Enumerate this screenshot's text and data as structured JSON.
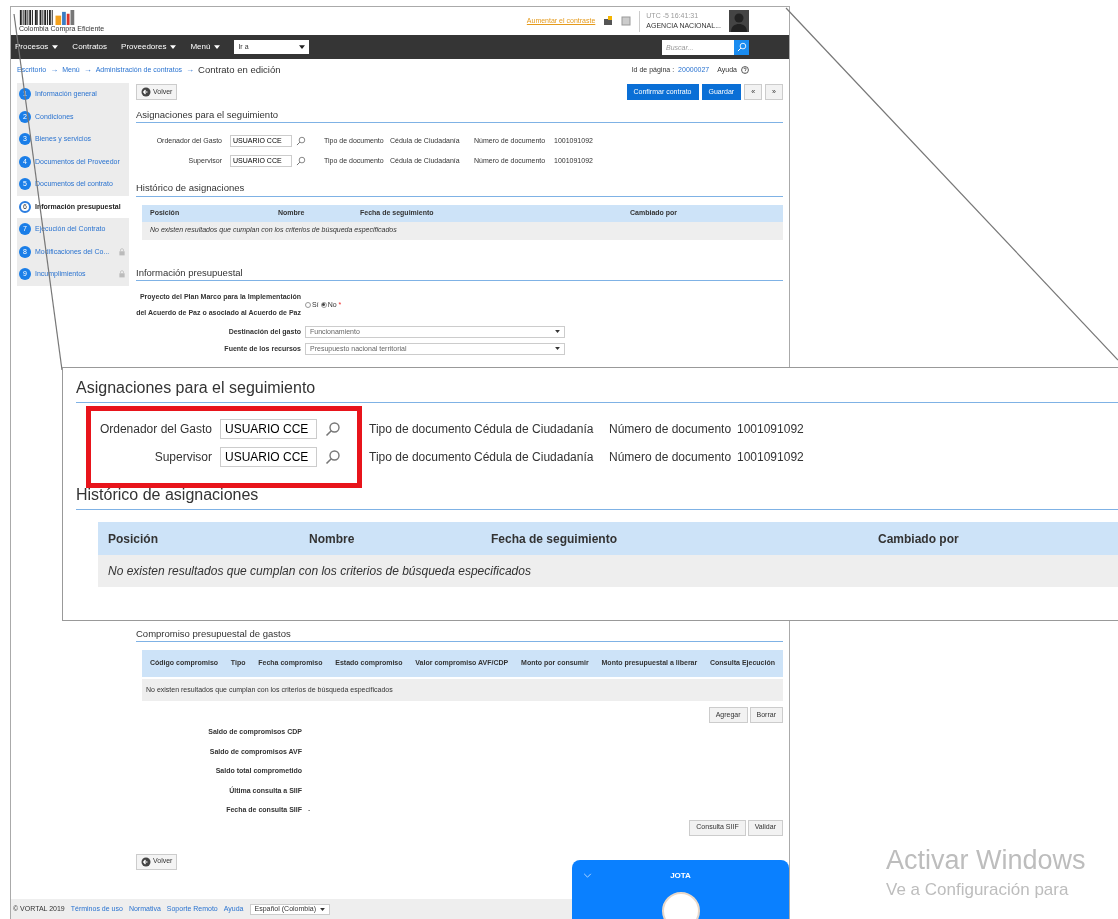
{
  "header": {
    "logo_caption": "Colombia Compra Eficiente",
    "contrast_link": "Aumentar el contraste",
    "time": "UTC -5 16:41:31",
    "agency": "AGENCIA NACIONAL..."
  },
  "nav": {
    "items": [
      {
        "label": "Procesos",
        "dropdown": true
      },
      {
        "label": "Contratos",
        "dropdown": false
      },
      {
        "label": "Proveedores",
        "dropdown": true
      },
      {
        "label": "Menú",
        "dropdown": true
      }
    ],
    "goto": "Ir a",
    "search": {
      "placeholder": "Buscar..."
    }
  },
  "breadcrumb": {
    "separator": "→",
    "links": [
      "Escritorio",
      "Menú",
      "Administración de contratos"
    ],
    "current": "Contrato en edición",
    "page_id_label": "Id de página :",
    "page_id": "20000027",
    "help": "Ayuda"
  },
  "steps": [
    {
      "number": "1",
      "label": "Información general",
      "selected": false,
      "locked": false
    },
    {
      "number": "2",
      "label": "Condiciones",
      "selected": false,
      "locked": false
    },
    {
      "number": "3",
      "label": "Bienes y servicios",
      "selected": false,
      "locked": false
    },
    {
      "number": "4",
      "label": "Documentos del Proveedor",
      "selected": false,
      "locked": false
    },
    {
      "number": "5",
      "label": "Documentos del contrato",
      "selected": false,
      "locked": false
    },
    {
      "number": "6",
      "label": "Información presupuestal",
      "selected": true,
      "locked": false
    },
    {
      "number": "7",
      "label": "Ejecución del Contrato",
      "selected": false,
      "locked": false
    },
    {
      "number": "8",
      "label": "Modificaciones del Co...",
      "selected": false,
      "locked": true
    },
    {
      "number": "9",
      "label": "Incumplimientos",
      "selected": false,
      "locked": true
    }
  ],
  "toolbar": {
    "back": "Volver",
    "buttons": [
      {
        "label": "Confirmar contrato",
        "kind": "primary"
      },
      {
        "label": "Guardar",
        "kind": "primary"
      },
      {
        "label": "«",
        "kind": "nav"
      },
      {
        "label": "»",
        "kind": "nav"
      }
    ]
  },
  "assignments": {
    "title": "Asignaciones para el seguimiento",
    "rows": [
      {
        "label": "Ordenador del Gasto",
        "value": "USUARIO CCE",
        "doc_type_label": "Tipo de documento",
        "doc_type": "Cédula de Ciudadanía",
        "doc_number_label": "Número de documento",
        "doc_number": "1001091092"
      },
      {
        "label": "Supervisor",
        "value": "USUARIO CCE",
        "doc_type_label": "Tipo de documento",
        "doc_type": "Cédula de Ciudadanía",
        "doc_number_label": "Número de documento",
        "doc_number": "1001091092"
      }
    ]
  },
  "history": {
    "title": "Histórico de asignaciones",
    "columns": [
      "Posición",
      "Nombre",
      "Fecha de seguimiento",
      "Cambiado por"
    ],
    "empty": "No existen resultados que cumplan con los criterios de búsqueda especificados"
  },
  "budget": {
    "title": "Información presupuestal",
    "peace_question": {
      "label_lines": [
        "Proyecto del Plan Marco para la Implementación",
        "del Acuerdo de Paz o asociado al Acuerdo de Paz"
      ],
      "options": [
        {
          "label": "Sí",
          "selected": false
        },
        {
          "label": "No",
          "selected": true
        }
      ],
      "required_mark": "*"
    },
    "selects": [
      {
        "label": "Destinación del gasto",
        "value": "Funcionamiento"
      },
      {
        "label": "Fuente de los recursos",
        "value": "Presupuesto nacional territorial"
      }
    ]
  },
  "callout": {
    "highlight_fields": true,
    "assignments": {
      "title": "Asignaciones para el seguimiento",
      "rows": [
        {
          "label": "Ordenador del Gasto",
          "value": "USUARIO CCE",
          "doc_type_label": "Tipo de documento",
          "doc_type": "Cédula de Ciudadanía",
          "doc_number_label": "Número de documento",
          "doc_number": "1001091092"
        },
        {
          "label": "Supervisor",
          "value": "USUARIO CCE",
          "doc_type_label": "Tipo de documento",
          "doc_type": "Cédula de Ciudadanía",
          "doc_number_label": "Número de documento",
          "doc_number": "1001091092"
        }
      ]
    },
    "history": {
      "title": "Histórico de asignaciones",
      "columns": [
        "Posición",
        "Nombre",
        "Fecha de seguimiento",
        "Cambiado por"
      ],
      "empty": "No existen resultados que cumplan con los criterios de búsqueda especificados"
    }
  },
  "commitments": {
    "title": "Compromiso presupuestal de gastos",
    "columns": [
      "Código compromiso",
      "Tipo",
      "Fecha compromiso",
      "Estado compromiso",
      "Valor compromiso AVF/CDP",
      "Monto por consumir",
      "Monto presupuestal a liberar",
      "Consulta Ejecución"
    ],
    "empty": "No existen resultados que cumplan con los criterios de búsqueda especificados",
    "buttons": [
      "Agregar",
      "Borrar"
    ],
    "summary": [
      {
        "label": "Saldo de compromisos CDP"
      },
      {
        "label": "Saldo de compromisos AVF"
      },
      {
        "label": "Saldo total comprometido"
      },
      {
        "label": "Última consulta a SIIF"
      },
      {
        "label": "Fecha de consulta SIIF",
        "value": "-"
      }
    ],
    "actions": [
      "Consulta SIIF",
      "Validar"
    ]
  },
  "back_bottom": "Volver",
  "footer": {
    "copyright": "© VORTAL 2019",
    "links": [
      "Términos de uso",
      "Normativa",
      "Soporte Remoto",
      "Ayuda"
    ],
    "language": "Español (Colombia)"
  },
  "chat": {
    "title": "JOTA"
  },
  "os_notice": {
    "title": "Activar Windows",
    "text": "Ve a Configuración para"
  }
}
